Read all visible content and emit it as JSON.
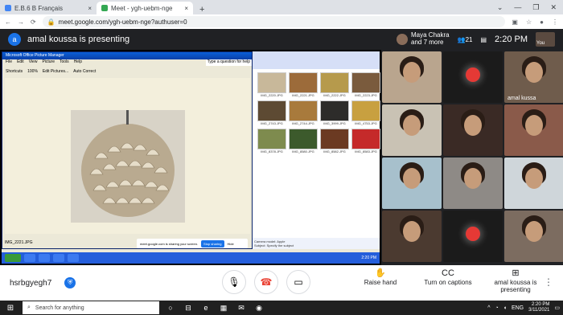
{
  "browser": {
    "tabs": [
      {
        "label": "E.B.6 B Français",
        "color": "#4285f4"
      },
      {
        "label": "Meet - ygh-uebm-nge",
        "color": "#34a853"
      }
    ],
    "close_glyph": "×",
    "new_tab": "+",
    "window_controls": [
      "⌄",
      "—",
      "❐",
      "✕"
    ],
    "url": "meet.google.com/ygh-uebm-nge?authuser=0",
    "nav_icons": [
      "←",
      "→",
      "⟳"
    ]
  },
  "meet": {
    "avatar_letter": "a",
    "presenting_title": "amal koussa is presenting",
    "attendees_line1": "Maya Chakra",
    "attendees_line2": "and 7 more",
    "people_count": "21",
    "time": "2:20 PM",
    "self_label": "You",
    "participants": [
      {
        "name": "",
        "bg": "#b9a58e"
      },
      {
        "name": "",
        "bg": "#1b1b1b",
        "type": "ball"
      },
      {
        "name": "amal kussa",
        "bg": "#6f5c4c"
      },
      {
        "name": "",
        "bg": "#c9c2b4"
      },
      {
        "name": "",
        "bg": "#3a2a25"
      },
      {
        "name": "",
        "bg": "#8a5a4a"
      },
      {
        "name": "",
        "bg": "#a7c0cc"
      },
      {
        "name": "",
        "bg": "#8e8a86"
      },
      {
        "name": "",
        "bg": "#cfd6da"
      },
      {
        "name": "",
        "bg": "#4b3a30"
      },
      {
        "name": "",
        "bg": "#1b1b1b",
        "type": "ball"
      },
      {
        "name": "",
        "bg": "#7c6c60"
      }
    ],
    "shared": {
      "window_title": "Microsoft Office Picture Manager",
      "menu": [
        "File",
        "Edit",
        "View",
        "Picture",
        "Tools",
        "Help"
      ],
      "toolbar": [
        "Shortcuts",
        "100%",
        "Edit Pictures...",
        "Auto Correct"
      ],
      "question_box": "Type a question for help",
      "status_file": "IMG_2221.JPG",
      "thumb_labels": [
        "IMG_2220.JPG",
        "IMG_2221.JPG",
        "IMG_2222.JPG",
        "IMG_2223.JPG",
        "IMG_2743.JPG",
        "IMG_2744.JPG",
        "IMG_3999.JPG",
        "IMG_4753.JPG",
        "IMG_8378.JPG",
        "IMG_8580.JPG",
        "IMG_8582.JPG",
        "IMG_8583.JPG"
      ],
      "thumb_colors": [
        "#c8b89a",
        "#9c6b3a",
        "#b69a4c",
        "#7a5b3d",
        "#5d4a33",
        "#a87a3c",
        "#2d2c2a",
        "#c8a040",
        "#7e8b4e",
        "#3c5a2c",
        "#6b3a22",
        "#c52a2a"
      ],
      "camera_model": "Camera model: Apple",
      "subject": "Subject: Specify the subject",
      "share_notice": "meet.google.com is sharing your screen.",
      "stop_label": "Stop sharing",
      "hide_label": "Hide",
      "xp_time": "2:20 PM"
    }
  },
  "controls": {
    "meeting_code": "hsrbgyegh7",
    "security_glyph": "⛨",
    "mic_glyph": "🎙",
    "hangup_glyph": "☎",
    "cam_glyph": "▭",
    "raise_hand": "Raise hand",
    "captions": "Turn on captions",
    "presenter": "amal koussa is presenting",
    "raise_glyph": "✋",
    "captions_glyph": "CC",
    "present_glyph": "⊞",
    "more_glyph": "⋮"
  },
  "taskbar": {
    "search_placeholder": "Search for anything",
    "lang": "ENG",
    "time": "2:20 PM",
    "date": "3/11/2021",
    "apps": [
      "○",
      "⊟",
      "e",
      "▦",
      "✉",
      "◉"
    ]
  }
}
